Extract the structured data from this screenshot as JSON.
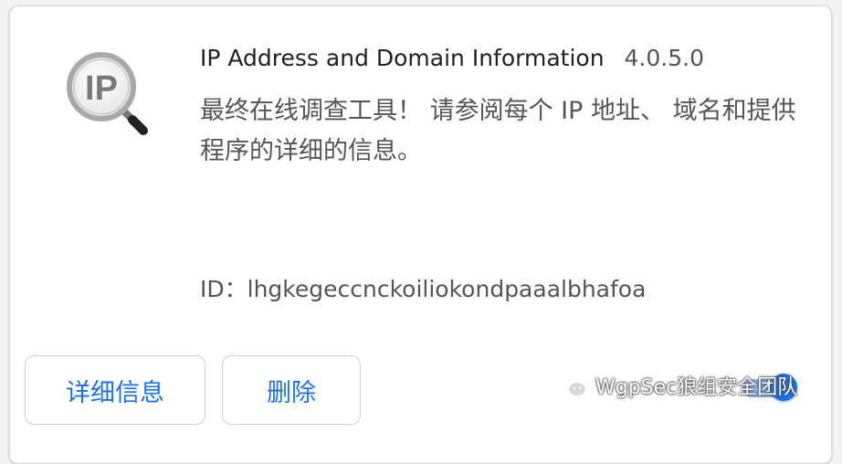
{
  "extension": {
    "name": "IP Address and Domain Information",
    "version": "4.0.5.0",
    "description": "最终在线调查工具！ 请参阅每个 IP 地址、 域名和提供程序的详细的信息。",
    "id_label": "ID：",
    "id_value": "lhgkegeccnckoiliokondpaaalbhafoa",
    "logo_text": "IP",
    "enabled": true
  },
  "buttons": {
    "details_label": "详细信息",
    "remove_label": "删除"
  },
  "watermark": {
    "text": "WgpSec狼组安全团队",
    "icon": "wechat-icon"
  },
  "colors": {
    "accent": "#1a73e8",
    "toggle_track": "#8ab4f8"
  }
}
